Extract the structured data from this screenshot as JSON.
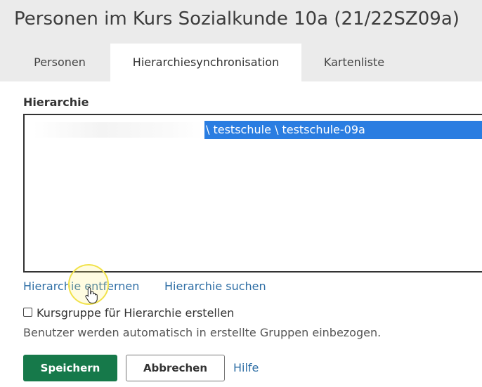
{
  "page": {
    "title": "Personen im Kurs Sozialkunde 10a (21/22SZ09a)"
  },
  "tabs": [
    {
      "label": "Personen",
      "active": false
    },
    {
      "label": "Hierarchiesynchronisation",
      "active": true
    },
    {
      "label": "Kartenliste",
      "active": false
    }
  ],
  "hierarchy": {
    "label": "Hierarchie",
    "items": [
      {
        "path": "\\ testschule \\ testschule-09a",
        "selected": true
      }
    ],
    "remove_link": "Hierarchie entfernen",
    "search_link": "Hierarchie suchen"
  },
  "options": {
    "checkbox_label": "Kursgruppe für Hierarchie erstellen",
    "checkbox_checked": false,
    "hint": "Benutzer werden automatisch in erstellte Gruppen einbezogen."
  },
  "actions": {
    "save_label": "Speichern",
    "cancel_label": "Abbrechen",
    "help_label": "Hilfe"
  },
  "colors": {
    "header_background": "#ebebeb",
    "selection": "#2a7de1",
    "primary_button": "#16794a",
    "link": "#2e6ea5",
    "cursor_highlight": "#f1e24a"
  }
}
